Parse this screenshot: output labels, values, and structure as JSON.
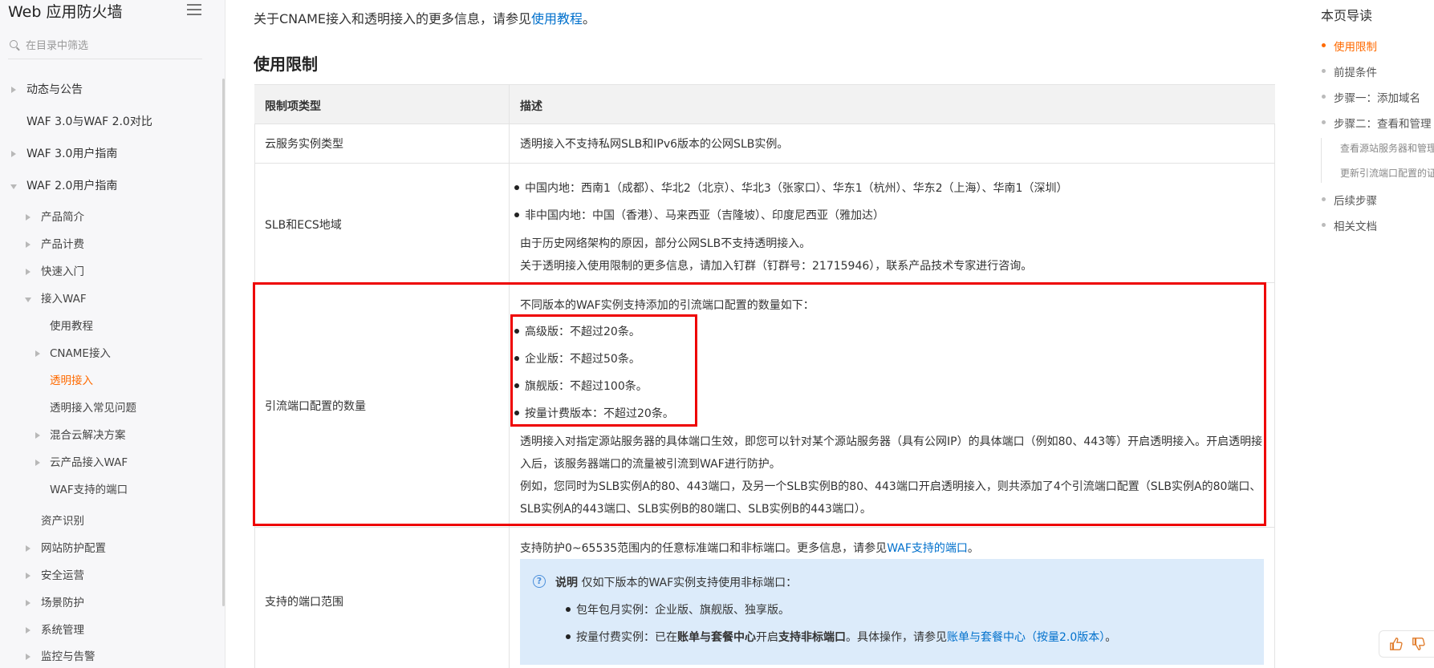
{
  "sidebar": {
    "title": "Web 应用防火墙",
    "search_placeholder": "在目录中筛选",
    "items": [
      {
        "label": "动态与公告"
      },
      {
        "label": "WAF 3.0与WAF 2.0对比"
      },
      {
        "label": "WAF 3.0用户指南"
      },
      {
        "label": "WAF 2.0用户指南"
      },
      {
        "label": "产品简介"
      },
      {
        "label": "产品计费"
      },
      {
        "label": "快速入门"
      },
      {
        "label": "接入WAF"
      },
      {
        "label": "使用教程"
      },
      {
        "label": "CNAME接入"
      },
      {
        "label": "透明接入"
      },
      {
        "label": "透明接入常见问题"
      },
      {
        "label": "混合云解决方案"
      },
      {
        "label": "云产品接入WAF"
      },
      {
        "label": "WAF支持的端口"
      },
      {
        "label": "资产识别"
      },
      {
        "label": "网站防护配置"
      },
      {
        "label": "安全运营"
      },
      {
        "label": "场景防护"
      },
      {
        "label": "系统管理"
      },
      {
        "label": "监控与告警"
      }
    ]
  },
  "main": {
    "intro_text": "关于CNAME接入和透明接入的更多信息，请参见",
    "intro_link": "使用教程",
    "intro_end": "。",
    "section_title": "使用限制",
    "table": {
      "headers": [
        "限制项类型",
        "描述"
      ],
      "row1": {
        "type": "云服务实例类型",
        "desc": "透明接入不支持私网SLB和IPv6版本的公网SLB实例。"
      },
      "row2": {
        "type": "SLB和ECS地域",
        "bullet1": "中国内地：西南1（成都）、华北2（北京）、华北3（张家口）、华东1（杭州）、华东2（上海）、华南1（深圳）",
        "bullet2": "非中国内地：中国（香港）、马来西亚（吉隆坡）、印度尼西亚（雅加达）",
        "line1": "由于历史网络架构的原因，部分公网SLB不支持透明接入。",
        "line2": "关于透明接入使用限制的更多信息，请加入钉群（钉群号：21715946），联系产品技术专家进行咨询。"
      },
      "row3": {
        "type": "引流端口配置的数量",
        "intro": "不同版本的WAF实例支持添加的引流端口配置的数量如下：",
        "bullets": [
          "高级版：不超过20条。",
          "企业版：不超过50条。",
          "旗舰版：不超过100条。",
          "按量计费版本：不超过20条。"
        ],
        "p1": "透明接入对指定源站服务器的具体端口生效，即您可以针对某个源站服务器（具有公网IP）的具体端口（例如80、443等）开启透明接入。开启透明接",
        "p2": "入后，该服务器端口的流量被引流到WAF进行防护。",
        "p3": "例如，您同时为SLB实例A的80、443端口，及另一个SLB实例B的80、443端口开启透明接入，则共添加了4个引流端口配置（SLB实例A的80端口、",
        "p4": "SLB实例A的443端口、SLB实例B的80端口、SLB实例B的443端口）。"
      },
      "row4": {
        "type": "支持的端口范围",
        "desc_text": "支持防护0~65535范围内的任意标准端口和非标端口。更多信息，请参见",
        "desc_link": "WAF支持的端口",
        "desc_end": "。",
        "note_label": "说明",
        "note_text": " 仅如下版本的WAF实例支持使用非标端口：",
        "note_b1": "包年包月实例：企业版、旗舰版、独享版。",
        "note_b2_a": "按量付费实例：已在",
        "note_b2_bold1": "账单与套餐中心",
        "note_b2_b": "开启",
        "note_b2_bold2": "支持非标端口",
        "note_b2_c": "。具体操作，请参见",
        "note_b2_link": "账单与套餐中心（按量2.0版本）",
        "note_b2_end": "。"
      }
    }
  },
  "toc": {
    "title": "本页导读",
    "items": [
      {
        "label": "使用限制"
      },
      {
        "label": "前提条件"
      },
      {
        "label": "步骤一：添加域名"
      },
      {
        "label": "步骤二：查看和管理"
      },
      {
        "label": "查看源站服务器和管理"
      },
      {
        "label": "更新引流端口配置的证"
      },
      {
        "label": "后续步骤"
      },
      {
        "label": "相关文档"
      }
    ]
  },
  "colors": {
    "accent": "#ff6a00",
    "link": "#0070cc",
    "highlight": "#ee0000",
    "note_bg": "#dcebfa"
  }
}
